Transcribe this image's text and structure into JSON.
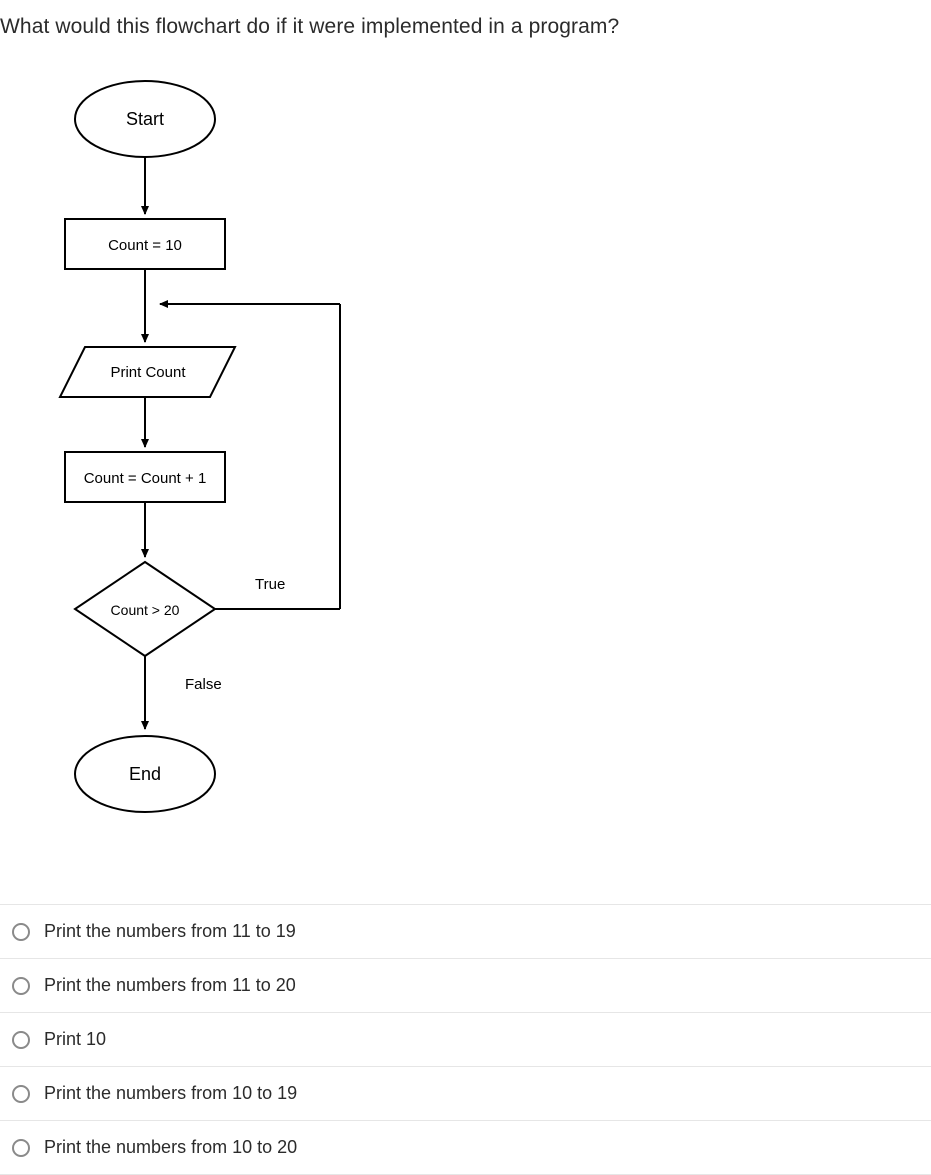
{
  "question": "What would this flowchart do if it were implemented in a program?",
  "flowchart": {
    "nodes": {
      "start": "Start",
      "init": "Count = 10",
      "print": "Print Count",
      "inc": "Count = Count + 1",
      "decision": "Count > 20",
      "true_label": "True",
      "false_label": "False",
      "end": "End"
    }
  },
  "options": [
    {
      "id": "opt1",
      "label": "Print the numbers from 11 to 19"
    },
    {
      "id": "opt2",
      "label": "Print the numbers from 11 to 20"
    },
    {
      "id": "opt3",
      "label": "Print 10"
    },
    {
      "id": "opt4",
      "label": "Print the numbers from 10 to 19"
    },
    {
      "id": "opt5",
      "label": "Print the numbers from 10 to 20"
    }
  ]
}
